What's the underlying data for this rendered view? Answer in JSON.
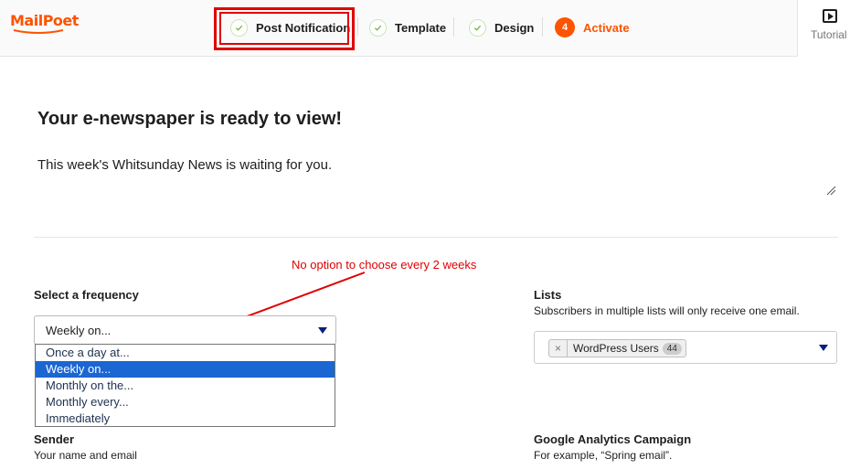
{
  "brand": {
    "logo_text": "MailPoet",
    "accent_color": "#fe5301"
  },
  "steps": [
    {
      "label": "Post Notification",
      "state": "done",
      "icon": "check-icon"
    },
    {
      "label": "Template",
      "state": "done",
      "icon": "check-icon"
    },
    {
      "label": "Design",
      "state": "done",
      "icon": "check-icon"
    },
    {
      "label": "Activate",
      "state": "active",
      "number": "4"
    }
  ],
  "tutorial": {
    "label": "Tutorial",
    "icon": "play-icon"
  },
  "email": {
    "subject": "Your e-newspaper is ready to view!",
    "preheader": "This week's Whitsunday News is waiting for you."
  },
  "annotation": {
    "text": "No option to choose every 2 weeks",
    "color": "#e00000"
  },
  "frequency": {
    "label": "Select a frequency",
    "selected": "Weekly on...",
    "options": [
      "Once a day at...",
      "Weekly on...",
      "Monthly on the...",
      "Monthly every...",
      "Immediately"
    ]
  },
  "lists": {
    "label": "Lists",
    "description": "Subscribers in multiple lists will only receive one email.",
    "selected_tags": [
      {
        "name": "WordPress Users",
        "count": "44"
      }
    ]
  },
  "sender": {
    "label": "Sender",
    "description": "Your name and email"
  },
  "google_analytics": {
    "label": "Google Analytics Campaign",
    "description": "For example, “Spring email”."
  }
}
